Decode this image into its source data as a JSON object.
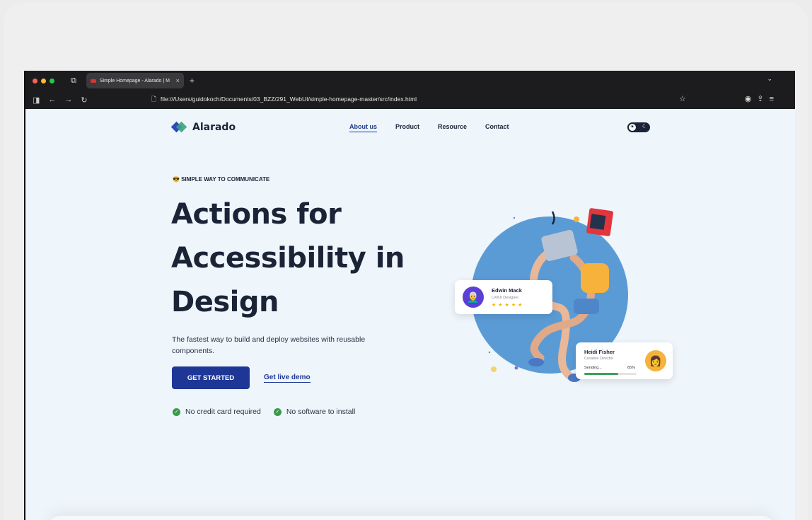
{
  "browser": {
    "tab_title": "Simple Homepage - Alarado | M",
    "tab_close": "×",
    "new_tab": "+",
    "url": "file:///Users/guidokoch/Documents/03_BZZ/291_WebUI/simple-homepage-master/src/index.html"
  },
  "site": {
    "logo_text": "Alarado",
    "nav": [
      "About us",
      "Product",
      "Resource",
      "Contact"
    ],
    "eyebrow": "😎 SIMPLE WAY TO COMMUNICATE",
    "headline_lines": [
      "Actions for",
      "Accessibility in",
      "Design"
    ],
    "subtitle": "The fastest way to build and deploy websites with reusable components.",
    "cta_primary": "GET STARTED",
    "cta_secondary": "Get live demo",
    "checks": [
      "No credit card required",
      "No software to install"
    ]
  },
  "cards": {
    "edwin": {
      "name": "Edwin Mack",
      "role": "UX/UI Designer",
      "rating": 5
    },
    "heidi": {
      "name": "Heidi Fisher",
      "role": "Creative Director",
      "status_label": "Sending...",
      "progress_text": "65%",
      "progress": 0.65
    }
  },
  "colors": {
    "primary": "#1e3796",
    "logo_blue": "#2c4bb8",
    "logo_green": "#3aa17e",
    "circle": "#5b9bd5",
    "check": "#3a9a4b"
  }
}
